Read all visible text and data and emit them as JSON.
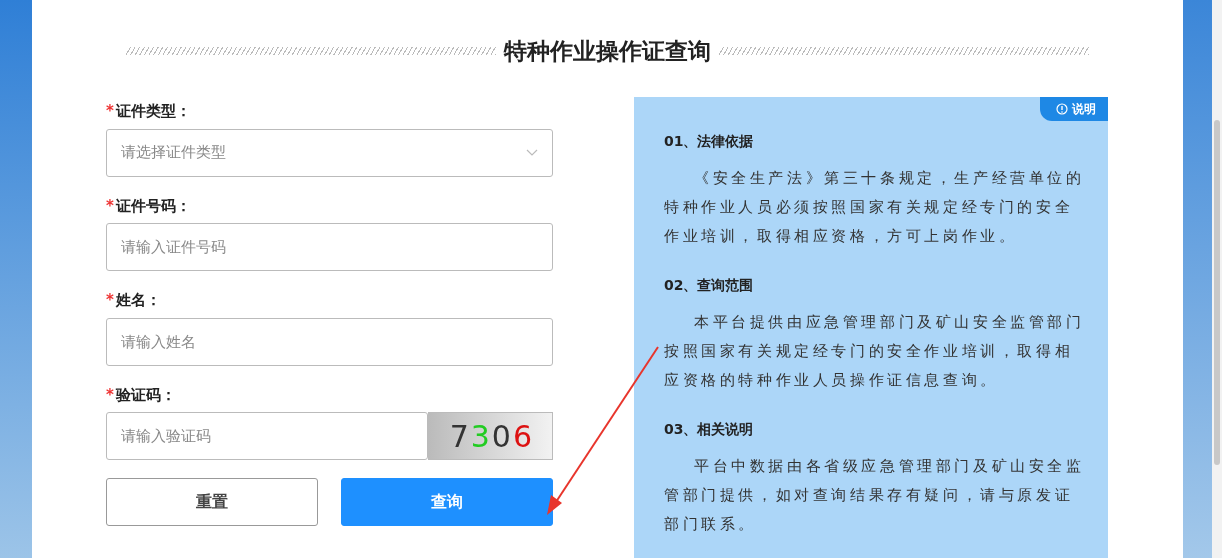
{
  "title": "特种作业操作证查询",
  "form": {
    "fields": [
      {
        "kind": "select",
        "label": "证件类型：",
        "required_mark": "*",
        "placeholder": "请选择证件类型"
      },
      {
        "kind": "text",
        "label": "证件号码：",
        "required_mark": "*",
        "placeholder": "请输入证件号码"
      },
      {
        "kind": "text",
        "label": "姓名：",
        "required_mark": "*",
        "placeholder": "请输入姓名"
      },
      {
        "kind": "captcha",
        "label": "验证码：",
        "required_mark": "*",
        "placeholder": "请输入验证码",
        "captcha": [
          {
            "text": "7",
            "color": "#333333"
          },
          {
            "text": "3",
            "color": "#22cc22"
          },
          {
            "text": "0",
            "color": "#333333"
          },
          {
            "text": "6",
            "color": "#dd1111"
          }
        ]
      }
    ],
    "buttons": [
      {
        "label": "重置",
        "kind": "secondary"
      },
      {
        "label": "查询",
        "kind": "primary"
      }
    ]
  },
  "info": {
    "badge": "说明",
    "sections": [
      {
        "heading": "01、法律依据",
        "text": "《安全生产法》第三十条规定，生产经营单位的特种作业人员必须按照国家有关规定经专门的安全作业培训，取得相应资格，方可上岗作业。"
      },
      {
        "heading": "02、查询范围",
        "text": "本平台提供由应急管理部门及矿山安全监管部门按照国家有关规定经专门的安全作业培训，取得相应资格的特种作业人员操作证信息查询。"
      },
      {
        "heading": "03、相关说明",
        "text": "平台中数据由各省级应急管理部门及矿山安全监管部门提供，如对查询结果存有疑问，请与原发证部门联系。"
      }
    ]
  }
}
